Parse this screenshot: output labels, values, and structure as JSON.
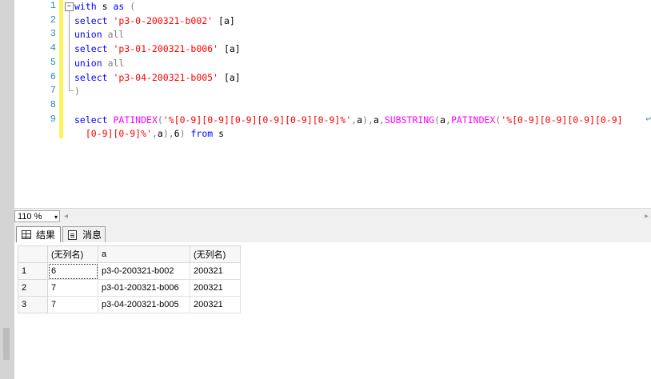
{
  "editor": {
    "line_numbers": [
      "1",
      "2",
      "3",
      "4",
      "5",
      "6",
      "7",
      "8",
      "9"
    ],
    "collapse_glyph": "−",
    "lines": [
      [
        {
          "t": "with",
          "c": "kw"
        },
        {
          "t": " s ",
          "c": "plain"
        },
        {
          "t": "as",
          "c": "kw"
        },
        {
          "t": " (",
          "c": "gray"
        }
      ],
      [
        {
          "t": "select",
          "c": "kw"
        },
        {
          "t": " 'p3-0-200321-b002'",
          "c": "str"
        },
        {
          "t": " [a]",
          "c": "plain"
        }
      ],
      [
        {
          "t": "union",
          "c": "kw"
        },
        {
          "t": " ",
          "c": "plain"
        },
        {
          "t": "all",
          "c": "gray"
        }
      ],
      [
        {
          "t": "select",
          "c": "kw"
        },
        {
          "t": " 'p3-01-200321-b006'",
          "c": "str"
        },
        {
          "t": " [a]",
          "c": "plain"
        }
      ],
      [
        {
          "t": "union",
          "c": "kw"
        },
        {
          "t": " ",
          "c": "plain"
        },
        {
          "t": "all",
          "c": "gray"
        }
      ],
      [
        {
          "t": "select",
          "c": "kw"
        },
        {
          "t": " 'p3-04-200321-b005'",
          "c": "str"
        },
        {
          "t": " [a]",
          "c": "plain"
        }
      ],
      [
        {
          "t": ")",
          "c": "gray"
        }
      ],
      [],
      [
        {
          "t": "select",
          "c": "kw"
        },
        {
          "t": " ",
          "c": "plain"
        },
        {
          "t": "PATINDEX",
          "c": "fn"
        },
        {
          "t": "(",
          "c": "gray"
        },
        {
          "t": "'%[0-9][0-9][0-9][0-9][0-9][0-9]%'",
          "c": "str"
        },
        {
          "t": ",",
          "c": "gray"
        },
        {
          "t": "a",
          "c": "plain"
        },
        {
          "t": "),",
          "c": "gray"
        },
        {
          "t": "a",
          "c": "plain"
        },
        {
          "t": ",",
          "c": "gray"
        },
        {
          "t": "SUBSTRING",
          "c": "fn"
        },
        {
          "t": "(",
          "c": "gray"
        },
        {
          "t": "a",
          "c": "plain"
        },
        {
          "t": ",",
          "c": "gray"
        },
        {
          "t": "PATINDEX",
          "c": "fn"
        },
        {
          "t": "(",
          "c": "gray"
        },
        {
          "t": "'%[0-9][0-9][0-9][0-9]",
          "c": "str"
        }
      ],
      [
        {
          "t": "  [0-9][0-9]%'",
          "c": "str"
        },
        {
          "t": ",",
          "c": "gray"
        },
        {
          "t": "a",
          "c": "plain"
        },
        {
          "t": "),",
          "c": "gray"
        },
        {
          "t": "6",
          "c": "plain"
        },
        {
          "t": ")",
          "c": "gray"
        },
        {
          "t": " ",
          "c": "plain"
        },
        {
          "t": "from",
          "c": "kw"
        },
        {
          "t": " s",
          "c": "plain"
        }
      ]
    ],
    "wrap_glyph": "↩"
  },
  "zoom": {
    "value": "110 %",
    "arrow": "▾"
  },
  "scroll": {
    "left_arrow": "◂",
    "right_arrow": "▸"
  },
  "tabs": {
    "results": "结果",
    "messages": "消息"
  },
  "grid": {
    "headers": [
      "(无列名)",
      "a",
      "(无列名)"
    ],
    "rows": [
      {
        "num": "1",
        "cells": [
          "6",
          "p3-0-200321-b002",
          "200321"
        ]
      },
      {
        "num": "2",
        "cells": [
          "7",
          "p3-01-200321-b006",
          "200321"
        ]
      },
      {
        "num": "3",
        "cells": [
          "7",
          "p3-04-200321-b005",
          "200321"
        ]
      }
    ]
  }
}
